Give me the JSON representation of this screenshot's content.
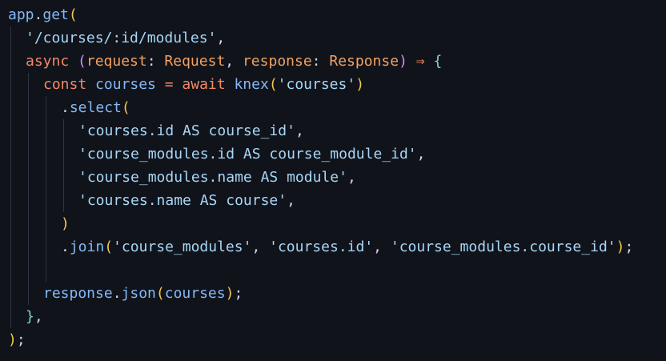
{
  "code": {
    "language": "typescript",
    "lines": [
      {
        "indent": 0,
        "tokens": [
          {
            "t": "app",
            "k": "ident"
          },
          {
            "t": ".",
            "k": "punct"
          },
          {
            "t": "get",
            "k": "func"
          },
          {
            "t": "(",
            "k": "br1"
          }
        ]
      },
      {
        "indent": 1,
        "tokens": [
          {
            "t": "'/courses/:id/modules'",
            "k": "string"
          },
          {
            "t": ",",
            "k": "punct"
          }
        ]
      },
      {
        "indent": 1,
        "tokens": [
          {
            "t": "async",
            "k": "kw"
          },
          {
            "t": " ",
            "k": "punct"
          },
          {
            "t": "(",
            "k": "br2"
          },
          {
            "t": "request",
            "k": "param"
          },
          {
            "t": ": ",
            "k": "punct"
          },
          {
            "t": "Request",
            "k": "type"
          },
          {
            "t": ", ",
            "k": "punct"
          },
          {
            "t": "response",
            "k": "param"
          },
          {
            "t": ": ",
            "k": "punct"
          },
          {
            "t": "Response",
            "k": "type"
          },
          {
            "t": ")",
            "k": "br2"
          },
          {
            "t": " ",
            "k": "punct"
          },
          {
            "t": "⇒",
            "k": "op"
          },
          {
            "t": " ",
            "k": "punct"
          },
          {
            "t": "{",
            "k": "br3"
          }
        ]
      },
      {
        "indent": 2,
        "tokens": [
          {
            "t": "const",
            "k": "kw"
          },
          {
            "t": " ",
            "k": "punct"
          },
          {
            "t": "courses",
            "k": "ident"
          },
          {
            "t": " ",
            "k": "punct"
          },
          {
            "t": "=",
            "k": "op"
          },
          {
            "t": " ",
            "k": "punct"
          },
          {
            "t": "await",
            "k": "kw"
          },
          {
            "t": " ",
            "k": "punct"
          },
          {
            "t": "knex",
            "k": "func"
          },
          {
            "t": "(",
            "k": "br1"
          },
          {
            "t": "'courses'",
            "k": "string"
          },
          {
            "t": ")",
            "k": "br1"
          }
        ]
      },
      {
        "indent": 3,
        "tokens": [
          {
            "t": ".",
            "k": "punct"
          },
          {
            "t": "select",
            "k": "func"
          },
          {
            "t": "(",
            "k": "br1"
          }
        ]
      },
      {
        "indent": 4,
        "tokens": [
          {
            "t": "'courses.id AS course_id'",
            "k": "string"
          },
          {
            "t": ",",
            "k": "punct"
          }
        ]
      },
      {
        "indent": 4,
        "tokens": [
          {
            "t": "'course_modules.id AS course_module_id'",
            "k": "string"
          },
          {
            "t": ",",
            "k": "punct"
          }
        ]
      },
      {
        "indent": 4,
        "tokens": [
          {
            "t": "'course_modules.name AS module'",
            "k": "string"
          },
          {
            "t": ",",
            "k": "punct"
          }
        ]
      },
      {
        "indent": 4,
        "tokens": [
          {
            "t": "'courses.name AS course'",
            "k": "string"
          },
          {
            "t": ",",
            "k": "punct"
          }
        ]
      },
      {
        "indent": 3,
        "tokens": [
          {
            "t": ")",
            "k": "br1"
          }
        ]
      },
      {
        "indent": 3,
        "tokens": [
          {
            "t": ".",
            "k": "punct"
          },
          {
            "t": "join",
            "k": "func"
          },
          {
            "t": "(",
            "k": "br1"
          },
          {
            "t": "'course_modules'",
            "k": "string"
          },
          {
            "t": ", ",
            "k": "punct"
          },
          {
            "t": "'courses.id'",
            "k": "string"
          },
          {
            "t": ", ",
            "k": "punct"
          },
          {
            "t": "'course_modules.course_id'",
            "k": "string"
          },
          {
            "t": ")",
            "k": "br1"
          },
          {
            "t": ";",
            "k": "punct"
          }
        ]
      },
      {
        "indent": 0,
        "tokens": []
      },
      {
        "indent": 2,
        "tokens": [
          {
            "t": "response",
            "k": "ident"
          },
          {
            "t": ".",
            "k": "punct"
          },
          {
            "t": "json",
            "k": "func"
          },
          {
            "t": "(",
            "k": "br1"
          },
          {
            "t": "courses",
            "k": "ident"
          },
          {
            "t": ")",
            "k": "br1"
          },
          {
            "t": ";",
            "k": "punct"
          }
        ]
      },
      {
        "indent": 1,
        "tokens": [
          {
            "t": "}",
            "k": "br3"
          },
          {
            "t": ",",
            "k": "punct"
          }
        ]
      },
      {
        "indent": 0,
        "tokens": [
          {
            "t": ")",
            "k": "br1"
          },
          {
            "t": ";",
            "k": "punct"
          }
        ]
      }
    ]
  },
  "theme": {
    "background": "#11131b",
    "identifier": "#83b9f6",
    "keyword": "#f28a66",
    "type": "#f2a261",
    "string": "#a7d7f7",
    "bracket_yellow": "#f2c94c",
    "bracket_purple": "#d48cff",
    "bracket_teal": "#7fd7c4"
  }
}
